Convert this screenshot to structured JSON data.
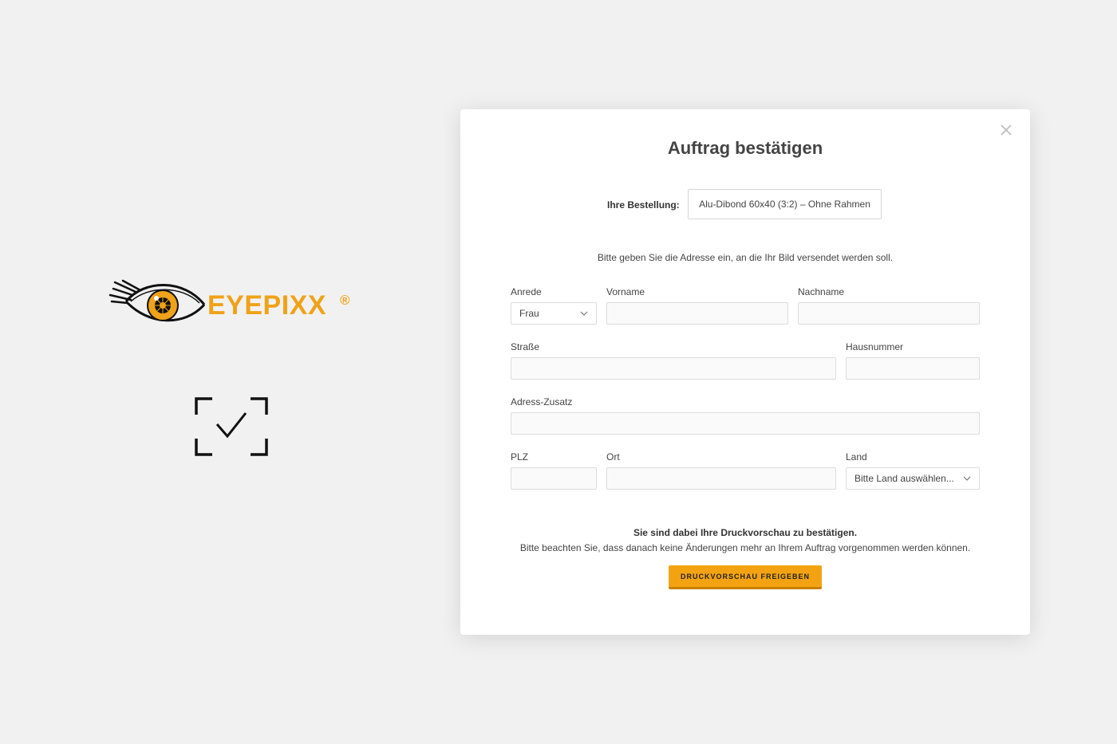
{
  "brand": {
    "name": "EYEPIXX",
    "registered_mark": "®",
    "accent_color": "#f0a218"
  },
  "side_icon": "dashed-frame-checkmark-icon",
  "modal": {
    "title": "Auftrag bestätigen",
    "close_icon": "close-icon",
    "order_label": "Ihre Bestellung:",
    "order_value": "Alu-Dibond 60x40 (3:2) – Ohne Rahmen",
    "instruction": "Bitte geben Sie die Adresse ein, an die Ihr Bild versendet werden soll.",
    "fields": {
      "anrede": {
        "label": "Anrede",
        "value": "Frau"
      },
      "vorname": {
        "label": "Vorname",
        "value": ""
      },
      "nachname": {
        "label": "Nachname",
        "value": ""
      },
      "strasse": {
        "label": "Straße",
        "value": ""
      },
      "hausnummer": {
        "label": "Hausnummer",
        "value": ""
      },
      "adresszusatz": {
        "label": "Adress-Zusatz",
        "value": ""
      },
      "plz": {
        "label": "PLZ",
        "value": ""
      },
      "ort": {
        "label": "Ort",
        "value": ""
      },
      "land": {
        "label": "Land",
        "value": "Bitte Land auswählen..."
      }
    },
    "confirm_bold": "Sie sind dabei Ihre Druckvorschau zu bestätigen.",
    "confirm_note": "Bitte beachten Sie, dass danach keine Änderungen mehr an Ihrem Auftrag vorgenommen werden können.",
    "submit_label": "DRUCKVORSCHAU FREIGEBEN",
    "submit_color": "#f3a312"
  }
}
